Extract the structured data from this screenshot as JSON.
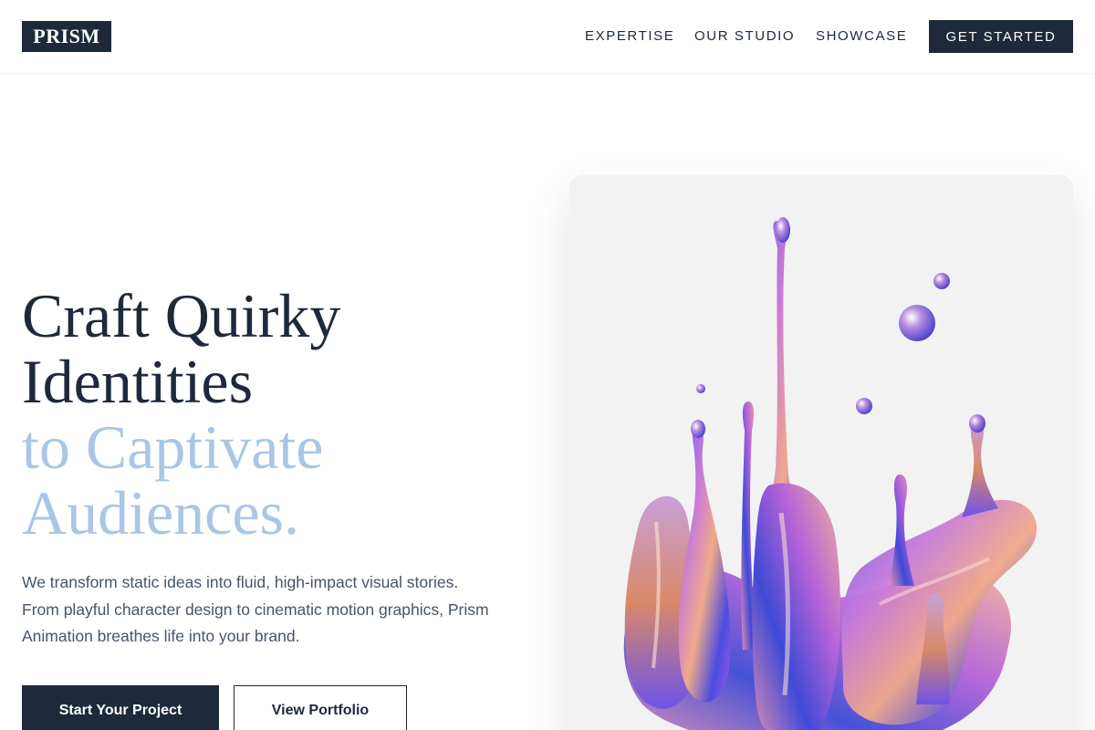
{
  "brand": {
    "logo": "PRISM"
  },
  "nav": {
    "items": [
      {
        "label": "EXPERTISE"
      },
      {
        "label": "OUR STUDIO"
      },
      {
        "label": "SHOWCASE"
      }
    ],
    "cta_label": "GET STARTED"
  },
  "hero": {
    "headline_dark_1": "Craft Quirky",
    "headline_dark_2": "Identities",
    "headline_light_1": "to Captivate",
    "headline_light_2": "Audiences.",
    "description": "We transform static ideas into fluid, high-impact visual stories. From playful character design to cinematic motion graphics, Prism Animation breathes life into your brand.",
    "primary_button": "Start Your Project",
    "secondary_button": "View Portfolio"
  },
  "art": {
    "subject": "iridescent liquid splash sculpture"
  },
  "colors": {
    "navy": "#1e293b",
    "accent_light_blue": "#a9c6e6",
    "body_text": "#475569",
    "card_bg": "#f2f2f3"
  }
}
